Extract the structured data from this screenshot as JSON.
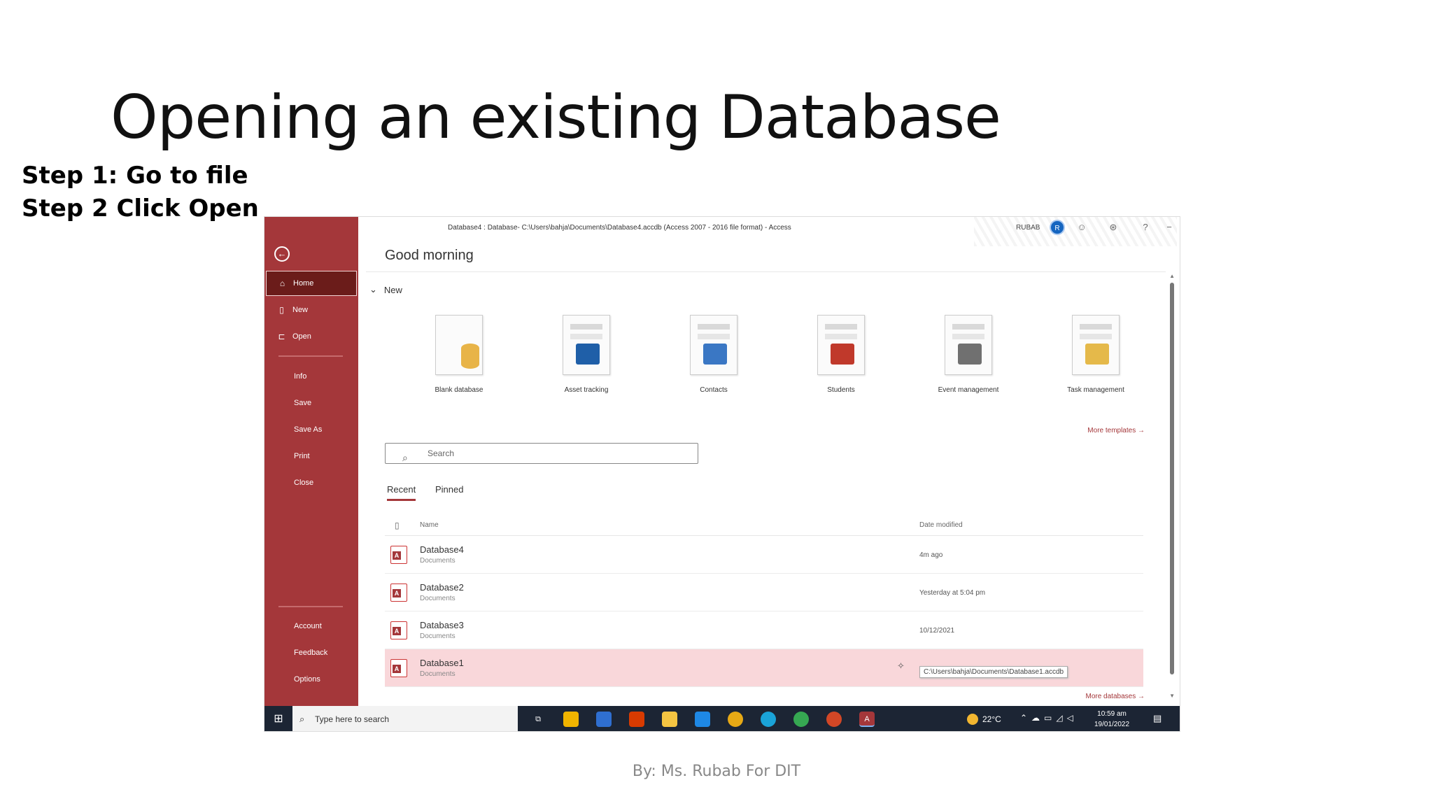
{
  "slide": {
    "title": "Opening an existing Database",
    "steps": [
      "Step 1: Go to file",
      "Step 2 Click Open"
    ],
    "footer": "By: Ms. Rubab For DIT"
  },
  "app": {
    "titlebar": "Database4 : Database- C:\\Users\\bahja\\Documents\\Database4.accdb (Access 2007 - 2016 file format)  -  Access",
    "user": "RUBAB",
    "avatar_initial": "R",
    "accent": "#a4373a"
  },
  "sidebar": {
    "back_icon": "back-arrow-icon",
    "primary": [
      {
        "label": "Home",
        "icon": "home-icon",
        "active": true
      },
      {
        "label": "New",
        "icon": "new-document-icon"
      },
      {
        "label": "Open",
        "icon": "folder-open-icon"
      }
    ],
    "secondary": [
      "Info",
      "Save",
      "Save As",
      "Print",
      "Close"
    ],
    "bottom": [
      "Account",
      "Feedback",
      "Options"
    ]
  },
  "main": {
    "greeting": "Good morning",
    "new_section": "New",
    "templates": [
      {
        "label": "Blank database"
      },
      {
        "label": "Asset tracking"
      },
      {
        "label": "Contacts"
      },
      {
        "label": "Students"
      },
      {
        "label": "Event management"
      },
      {
        "label": "Task management"
      }
    ],
    "more_templates": "More templates",
    "search_placeholder": "Search",
    "tabs": [
      "Recent",
      "Pinned"
    ],
    "columns": {
      "name": "Name",
      "date": "Date modified"
    },
    "files": [
      {
        "name": "Database4",
        "location": "Documents",
        "date": "4m ago"
      },
      {
        "name": "Database2",
        "location": "Documents",
        "date": "Yesterday at 5:04 pm"
      },
      {
        "name": "Database3",
        "location": "Documents",
        "date": "10/12/2021"
      },
      {
        "name": "Database1",
        "location": "Documents",
        "date": "",
        "tooltip": "C:\\Users\\bahja\\Documents\\Database1.accdb"
      }
    ],
    "more_databases": "More databases"
  },
  "taskbar": {
    "search_placeholder": "Type here to search",
    "temperature": "22°C",
    "time": "10:59 am",
    "date": "19/01/2022"
  }
}
